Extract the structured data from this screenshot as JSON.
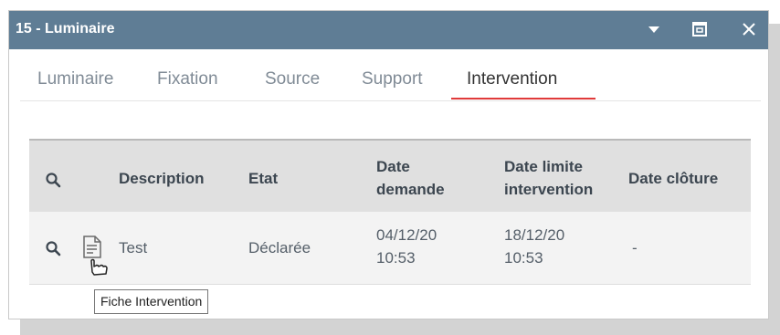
{
  "window": {
    "title": "15 - Luminaire",
    "controls": {
      "dropdown_icon": "caret-down-icon",
      "restore_icon": "restore-window-icon",
      "close_icon": "close-icon"
    }
  },
  "tabs": [
    {
      "label": "Luminaire",
      "active": false
    },
    {
      "label": "Fixation",
      "active": false
    },
    {
      "label": "Source",
      "active": false
    },
    {
      "label": "Support",
      "active": false
    },
    {
      "label": "Intervention",
      "active": true
    }
  ],
  "grid": {
    "headers": {
      "search_icon": "search-icon",
      "description": "Description",
      "etat": "Etat",
      "date_demande_line1": "Date",
      "date_demande_line2": "demande",
      "date_limite_line1": "Date limite",
      "date_limite_line2": "intervention",
      "date_cloture": "Date clôture"
    },
    "rows": [
      {
        "search_icon": "search-icon",
        "doc_icon": "document-icon",
        "description": "Test",
        "etat": "Déclarée",
        "date_demande_date": "04/12/20",
        "date_demande_time": "10:53",
        "date_limite_date": "18/12/20",
        "date_limite_time": "10:53",
        "date_cloture": "-"
      }
    ]
  },
  "tooltip": {
    "text": "Fiche Intervention"
  },
  "colors": {
    "titlebar": "#5f7d95",
    "active_tab_underline": "#e03a3a",
    "header_bg": "#e0e0e0",
    "row_bg": "#f3f3f3"
  }
}
